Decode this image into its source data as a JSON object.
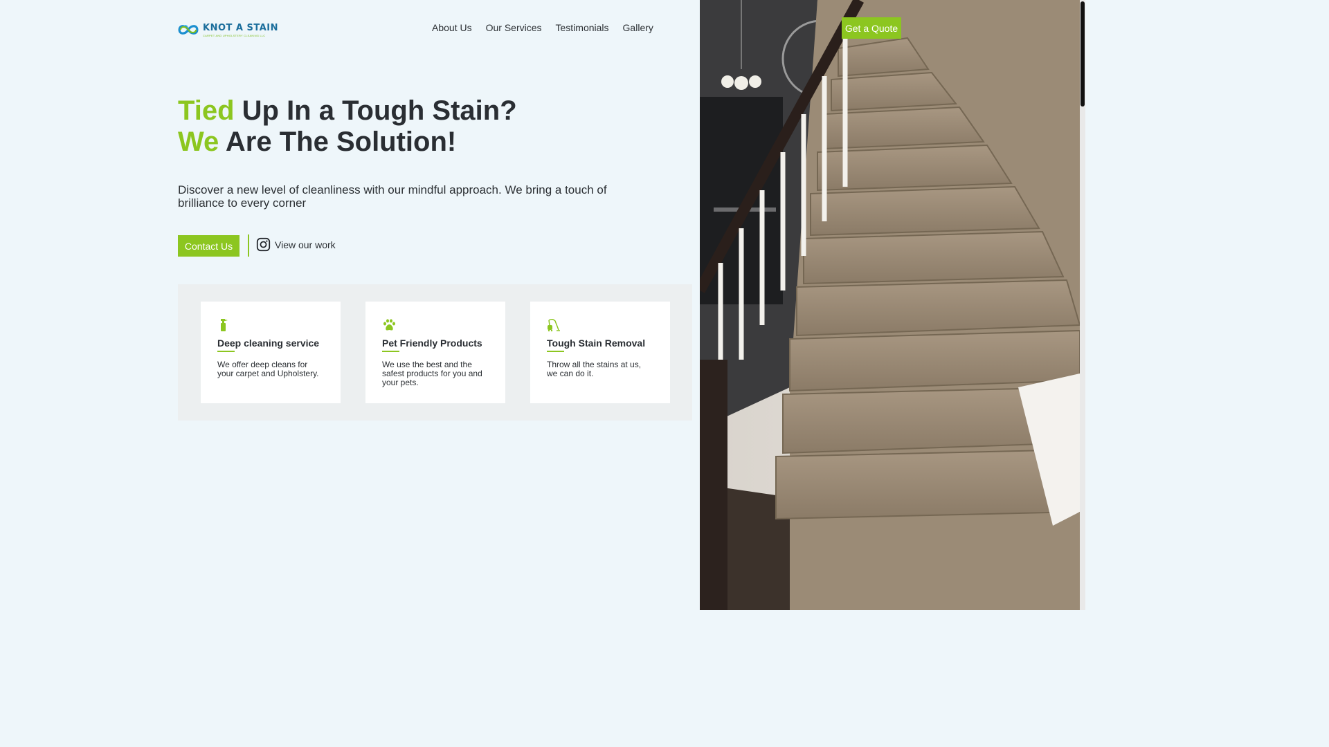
{
  "brand": {
    "name": "KNOT A STAIN",
    "tagline": "CARPET AND UPHOLSTERY CLEANING LLC",
    "accent_color": "#8cc620",
    "primary_color": "#1b6e9c"
  },
  "nav": {
    "items": [
      {
        "label": "About Us"
      },
      {
        "label": "Our Services"
      },
      {
        "label": "Testimonials"
      },
      {
        "label": "Gallery"
      }
    ],
    "quote_label": "Get a Quote"
  },
  "hero": {
    "line1_accent": "Tied",
    "line1_rest": " Up In a Tough Stain?",
    "line2_accent": "We",
    "line2_rest": " Are The Solution!",
    "description": "Discover a new level of cleanliness with our mindful approach. We bring a touch of brilliance to every corner",
    "contact_label": "Contact Us",
    "view_work_label": "View our work"
  },
  "features": [
    {
      "icon": "spray-bottle-icon",
      "title": "Deep cleaning service",
      "text": "We offer deep cleans for your carpet and Upholstery."
    },
    {
      "icon": "paw-icon",
      "title": "Pet Friendly Products",
      "text": "We use the best and the safest products for you and your pets."
    },
    {
      "icon": "vacuum-icon",
      "title": "Tough Stain Removal",
      "text": "Throw all the stains at us, we can do it."
    }
  ]
}
